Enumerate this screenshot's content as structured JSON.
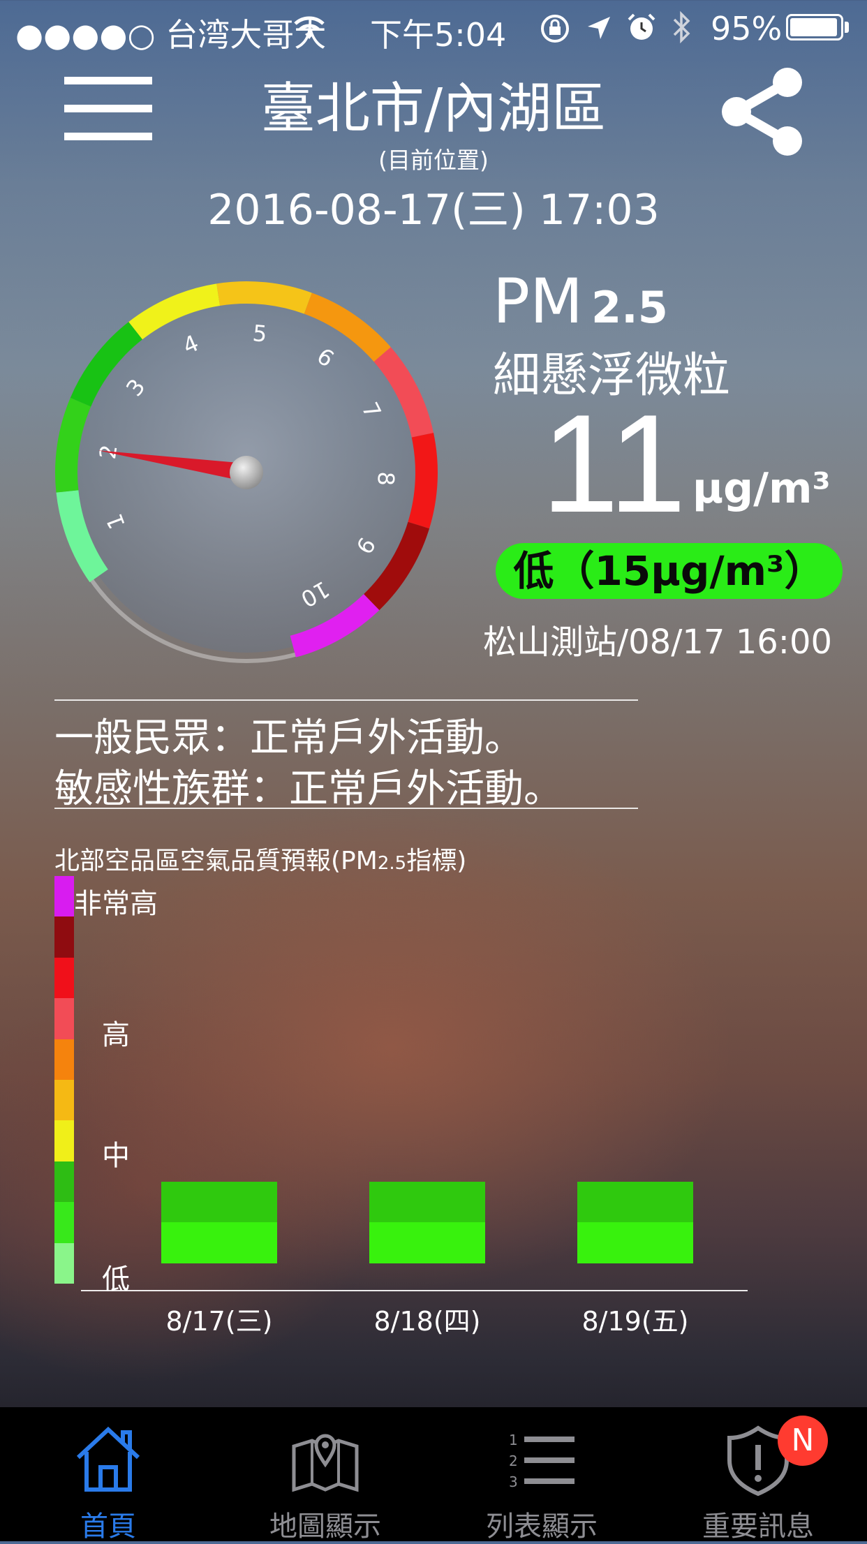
{
  "status_bar": {
    "carrier": "●●●●○ 台湾大哥大",
    "time": "下午5:04",
    "battery": "95%",
    "battery_level": 0.95
  },
  "header": {
    "location": "臺北市/內湖區",
    "location_note": "(目前位置)",
    "datetime": "2016-08-17(三) 17:03"
  },
  "gauge": {
    "ticks": [
      "1",
      "2",
      "3",
      "4",
      "5",
      "6",
      "7",
      "8",
      "9",
      "10"
    ],
    "needle_value": 2.0,
    "colors": [
      "#6ef59a",
      "#33d11a",
      "#18c214",
      "#f0f21a",
      "#f5c418",
      "#f5970f",
      "#f24c56",
      "#f21717",
      "#a00c0c",
      "#e020f0"
    ]
  },
  "reading": {
    "pm_label": "PM",
    "pm_sub": "2.5",
    "pm_desc": "細懸浮微粒",
    "value": "11",
    "unit": "μg/m³",
    "level_label": "低（15μg/m³）",
    "level_color": "#2aec17",
    "station": "松山測站/08/17 16:00"
  },
  "advice": {
    "general": "一般民眾：正常戶外活動。",
    "sensitive": "敏感性族群：正常戶外活動。"
  },
  "forecast": {
    "title_a": "北部空品區空氣品質預報(PM",
    "title_sub": "2.5",
    "title_b": "指標)",
    "levels": {
      "very_high": "非常高",
      "high": "高",
      "medium": "中",
      "low": "低"
    },
    "scale_colors": [
      "#d81cf0",
      "#8f0c10",
      "#f0101a",
      "#f24c56",
      "#f5830d",
      "#f5b914",
      "#f0ef19",
      "#2ebd14",
      "#38e81b",
      "#8af58a"
    ],
    "days": [
      "8/17(三)",
      "8/18(四)",
      "8/19(五)"
    ],
    "values": [
      2,
      2,
      2
    ]
  },
  "tabs": [
    {
      "label": "首頁",
      "icon": "home-icon",
      "active": true
    },
    {
      "label": "地圖顯示",
      "icon": "map-icon",
      "active": false
    },
    {
      "label": "列表顯示",
      "icon": "list-icon",
      "active": false
    },
    {
      "label": "重要訊息",
      "icon": "alert-shield-icon",
      "active": false
    }
  ],
  "notification_badge": "N"
}
